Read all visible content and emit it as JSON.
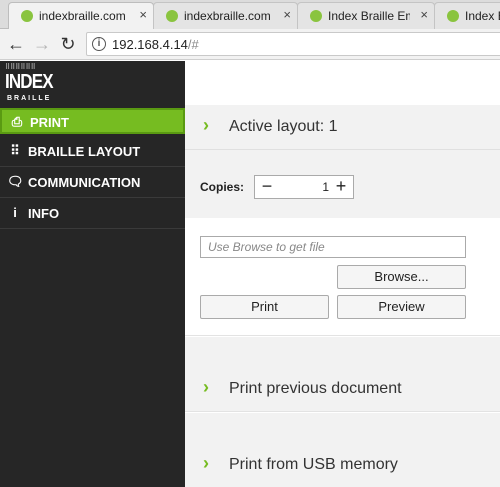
{
  "browser": {
    "tabs": [
      {
        "title": "indexbraille.com",
        "active": true
      },
      {
        "title": "indexbraille.com",
        "active": false
      },
      {
        "title": "Index Braille Emb",
        "active": false
      },
      {
        "title": "Index Br",
        "active": false
      }
    ],
    "tab_close_glyph": "×",
    "url_host": "192.168.4.14",
    "url_rest": "/#",
    "back_glyph": "←",
    "forward_glyph": "→",
    "reload_glyph": "↻",
    "info_glyph": "i"
  },
  "logo": {
    "word": "INDEX",
    "sub": "BRAILLE",
    "dots": "⠿⠿⠿⠿⠿⠿"
  },
  "sidebar": {
    "items": [
      {
        "label": "PRINT",
        "icon": "printer-icon",
        "glyph": "⎙",
        "active": true
      },
      {
        "label": "BRAILLE LAYOUT",
        "icon": "braille-layout-icon",
        "glyph": "⠿",
        "active": false
      },
      {
        "label": "COMMUNICATION",
        "icon": "chat-icon",
        "glyph": "🗨",
        "active": false
      },
      {
        "label": "INFO",
        "icon": "info-icon",
        "glyph": "i",
        "active": false
      }
    ]
  },
  "main": {
    "active_layout": "Active layout: 1",
    "copies_label": "Copies:",
    "copies_value": "1",
    "minus_glyph": "−",
    "plus_glyph": "+",
    "file_placeholder": "Use Browse to get file",
    "browse_label": "Browse...",
    "print_label": "Print",
    "preview_label": "Preview",
    "print_previous": "Print previous document",
    "print_usb": "Print from USB memory",
    "chevron_glyph": "›"
  },
  "colors": {
    "accent": "#76bc21",
    "sidebar_bg": "#262626"
  }
}
